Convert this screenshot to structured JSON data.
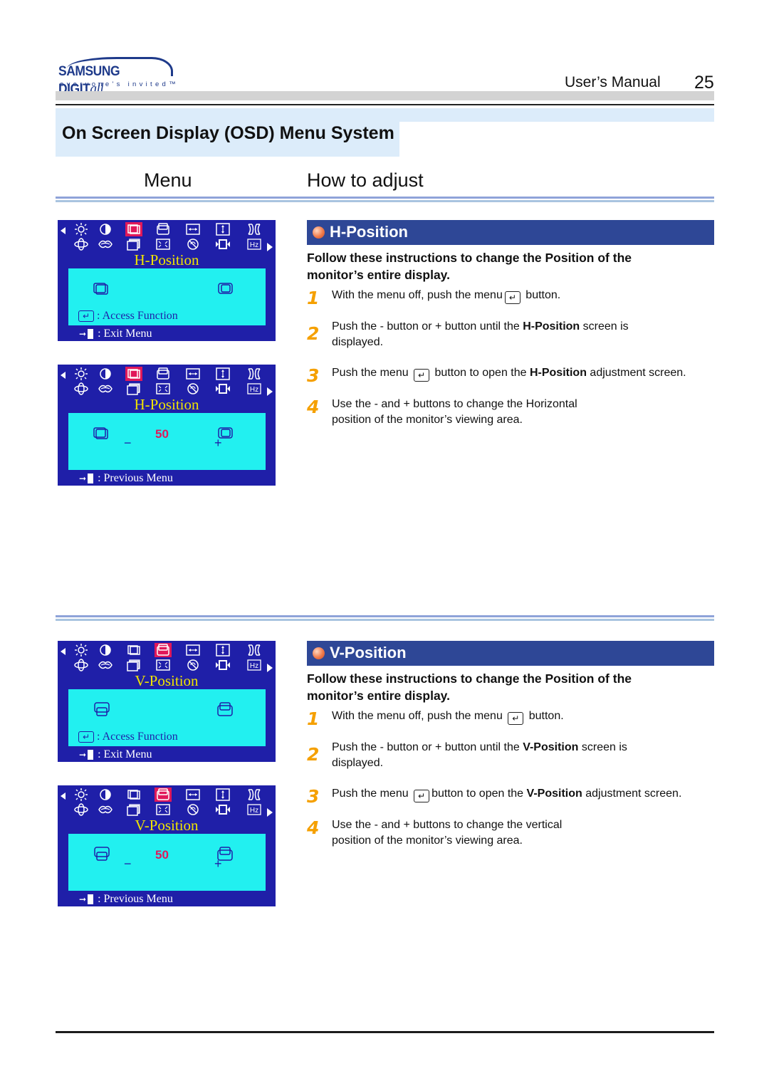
{
  "header": {
    "logo_main": "SAMSUNG DIGIT",
    "logo_all": "all",
    "logo_tagline": "everyone's invited™",
    "manual_label": "User’s  Manual",
    "page_number": "25"
  },
  "section_title": "On Screen Display (OSD) Menu System",
  "columns": {
    "menu": "Menu",
    "how": "How to adjust"
  },
  "osd_icons": {
    "row1": [
      "brightness-icon",
      "contrast-icon",
      "h-position-icon",
      "v-position-icon",
      "h-size-icon",
      "v-size-icon",
      "pincushion-icon"
    ],
    "row2": [
      "rotation-icon",
      "moire-icon",
      "recall-icon",
      "zoom-icon",
      "degauss-icon",
      "trapezoid-icon",
      "hz-icon"
    ],
    "hz_label": "Hz"
  },
  "osd_screens": {
    "h_main": {
      "title": "H-Position",
      "access": ": Access Function",
      "exit": ": Exit Menu"
    },
    "h_adj": {
      "title": "H-Position",
      "value": "50",
      "minus": "−",
      "plus": "+",
      "exit": ": Previous Menu"
    },
    "v_main": {
      "title": "V-Position",
      "access": ": Access Function",
      "exit": ": Exit Menu"
    },
    "v_adj": {
      "title": "V-Position",
      "value": "50",
      "minus": "−",
      "plus": "+",
      "exit": ": Previous Menu"
    }
  },
  "h_section": {
    "title": "H-Position",
    "intro": "Follow these instructions to change the  Position of the monitor’s entire display.",
    "steps": [
      {
        "num": "1",
        "a": "With the menu off, push the menu",
        "b": " button."
      },
      {
        "num": "2",
        "a": "Push the  - button or  + button until the  ",
        "bold": "H-Position",
        "b": " screen is",
        "c": "displayed."
      },
      {
        "num": "3",
        "a": "Push the menu ",
        "b": " button to open the ",
        "bold": "H-Position",
        "c": " adjustment screen."
      },
      {
        "num": "4",
        "a": "Use the  - and  + buttons to change the Horizontal",
        "b": "position of the monitor’s viewing area."
      }
    ]
  },
  "v_section": {
    "title": "V-Position",
    "intro": "Follow these instructions to change the  Position of the monitor’s entire display.",
    "steps": [
      {
        "num": "1",
        "a": "With the menu off, push the menu ",
        "b": " button."
      },
      {
        "num": "2",
        "a": "Push the  - button or  + button until the  ",
        "bold": "V-Position",
        "b": "  screen is",
        "c": "displayed."
      },
      {
        "num": "3",
        "a": "Push the menu ",
        "b": "button to open the ",
        "bold": "V-Position",
        "c": " adjustment screen."
      },
      {
        "num": "4",
        "a": "Use the  - and  + buttons to change the vertical",
        "b": "position of the monitor’s viewing area."
      }
    ]
  },
  "enter_key_glyph": "↵",
  "colors": {
    "osd_blue": "#1f1fa8",
    "osd_cyan": "#22f0f0",
    "osd_select": "#e0185a",
    "osd_title_yellow": "#f0e400",
    "section_head_blue": "#2e4796",
    "step_orange": "#f5a000"
  }
}
